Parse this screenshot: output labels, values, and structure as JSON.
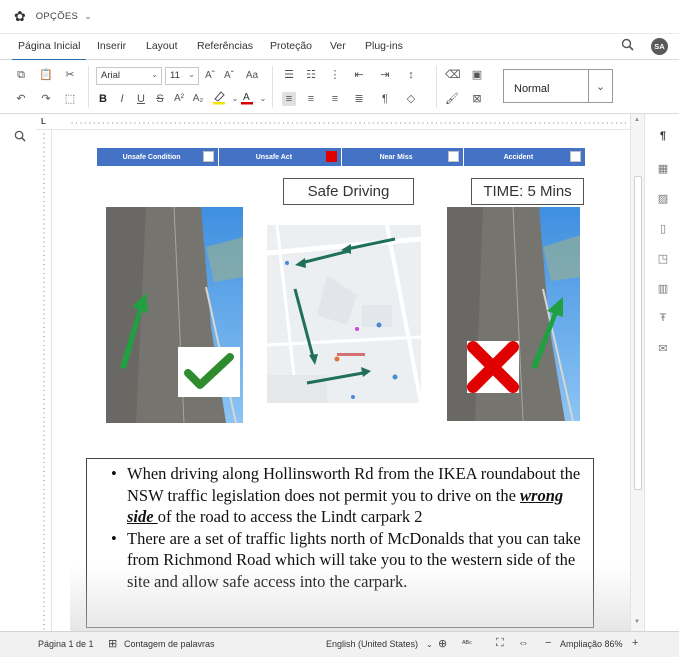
{
  "options_bar": {
    "label": "OPÇÕES"
  },
  "menu": {
    "tabs": [
      "Página Inicial",
      "Inserir",
      "Layout",
      "Referências",
      "Proteção",
      "Ver",
      "Plug-ins"
    ],
    "active_tab": "Página Inicial",
    "avatar_initials": "SA"
  },
  "toolbar": {
    "font_name": "Arial",
    "font_size": "11",
    "style_name": "Normal",
    "bold": "B",
    "italic": "I",
    "underline": "U",
    "strike": "S",
    "superscript": "A²",
    "subscript": "A₂",
    "grow_font": "Aˆ",
    "shrink_font": "Aˇ",
    "change_case": "Aa",
    "highlight_color": "#f2e600",
    "font_color": "#d40000"
  },
  "document": {
    "hazard_bar": [
      {
        "label": "Unsafe Condition",
        "checked": false
      },
      {
        "label": "Unsafe Act",
        "checked": true
      },
      {
        "label": "Near Miss",
        "checked": false
      },
      {
        "label": "Accident",
        "checked": false
      }
    ],
    "title": "Safe Driving",
    "time_label": "TIME: 5 Mins",
    "bullets": [
      {
        "before": "When driving along Hollinsworth Rd from the IKEA roundabout the NSW traffic legislation does not permit you to drive on the ",
        "emph": "wrong side ",
        "after": "of the road to access the Lindt carpark 2"
      },
      {
        "before": "There are a set of traffic lights north of McDonalds that you can take from Richmond Road which will take you to the western side of the site and allow safe access into the carpark.",
        "emph": "",
        "after": ""
      }
    ]
  },
  "status": {
    "page": "Página 1 de 1",
    "word_count": "Contagem de palavras",
    "language": "English (United States)",
    "zoom": "Ampliação 86%"
  },
  "colors": {
    "hazard_blue": "#4472c4",
    "check_green": "#2e8b2e",
    "cross_red": "#e00000",
    "arrow_green": "#2f7d5b"
  }
}
